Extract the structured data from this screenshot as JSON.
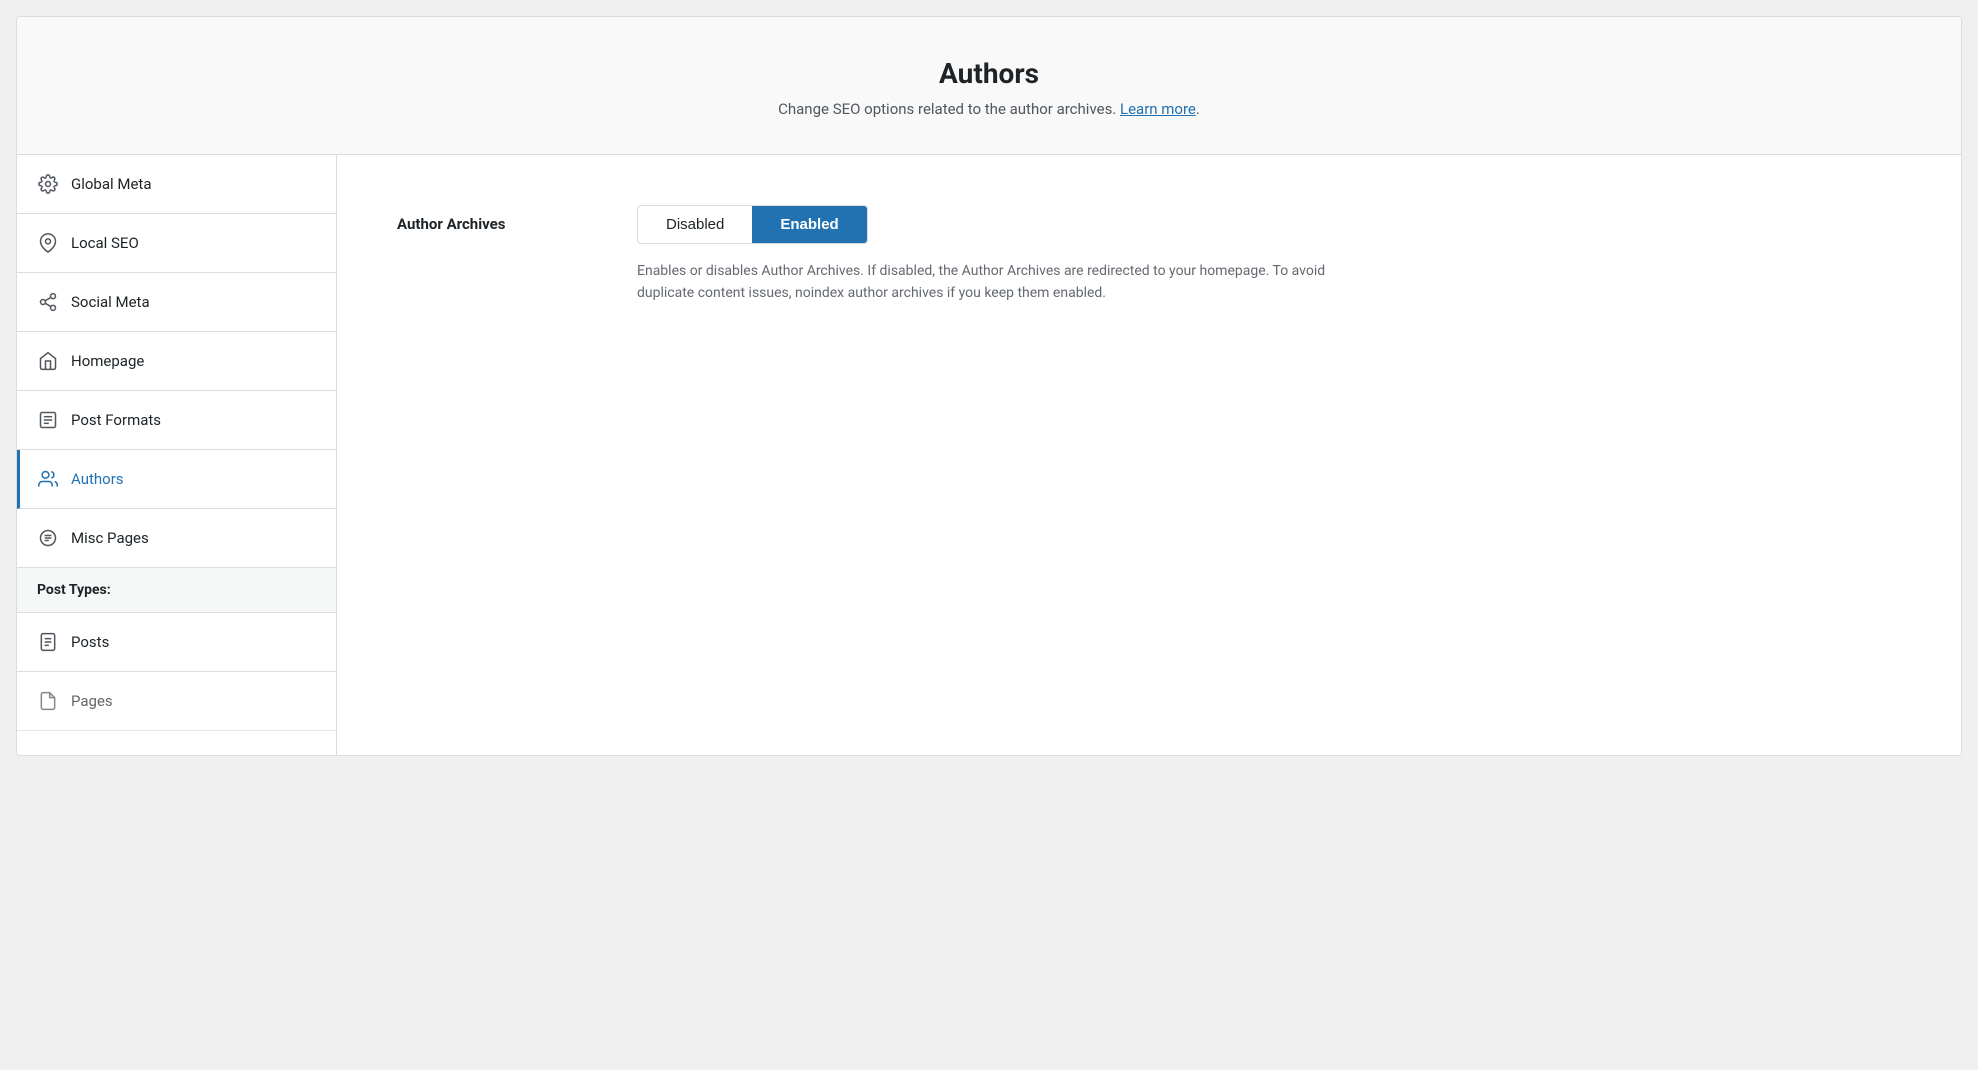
{
  "header": {
    "title": "Authors",
    "description": "Change SEO options related to the author archives.",
    "learn_more_label": "Learn more",
    "learn_more_url": "#"
  },
  "sidebar": {
    "items": [
      {
        "id": "global-meta",
        "label": "Global Meta",
        "icon": "gear",
        "active": false
      },
      {
        "id": "local-seo",
        "label": "Local SEO",
        "icon": "location",
        "active": false
      },
      {
        "id": "social-meta",
        "label": "Social Meta",
        "icon": "social",
        "active": false
      },
      {
        "id": "homepage",
        "label": "Homepage",
        "icon": "home",
        "active": false
      },
      {
        "id": "post-formats",
        "label": "Post Formats",
        "icon": "document-list",
        "active": false
      },
      {
        "id": "authors",
        "label": "Authors",
        "icon": "users",
        "active": true
      }
    ],
    "misc_section": {
      "item": {
        "id": "misc-pages",
        "label": "Misc Pages",
        "icon": "list-circles"
      }
    },
    "post_types_section": {
      "label": "Post Types:",
      "items": [
        {
          "id": "posts",
          "label": "Posts",
          "icon": "document-lines"
        },
        {
          "id": "pages",
          "label": "Pages",
          "icon": "document"
        }
      ]
    }
  },
  "content": {
    "author_archives": {
      "label": "Author Archives",
      "toggle": {
        "disabled_label": "Disabled",
        "enabled_label": "Enabled",
        "current": "enabled"
      },
      "description": "Enables or disables Author Archives. If disabled, the Author Archives are redirected to your homepage. To avoid duplicate content issues, noindex author archives if you keep them enabled."
    }
  }
}
